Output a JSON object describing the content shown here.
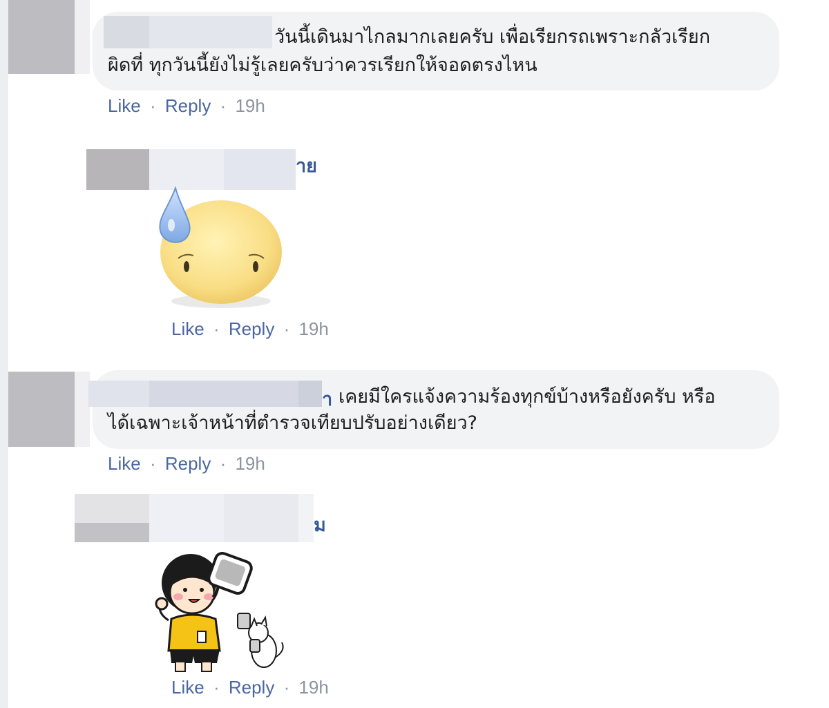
{
  "comments": [
    {
      "name_tail": "",
      "text_lines": [
        "วันนี้เดินมาไกลมากเลยครับ เพื่อเรียกรถเพราะกลัวเรียก",
        "ผิดที่ ทุกวันนี้ยังไม่รู้เลยครับว่าควรเรียกให้จอดตรงไหน"
      ],
      "like": "Like",
      "reply": "Reply",
      "time": "19h"
    },
    {
      "name_tail": "าย",
      "sticker": "sweating-blob-sticker",
      "like": "Like",
      "reply": "Reply",
      "time": "19h"
    },
    {
      "name_tail": "า",
      "text_lines": [
        "เคยมีใครแจ้งความร้องทุกข์บ้างหรือยังครับ หรือ",
        "ได้เฉพาะเจ้าหน้าที่ตำรวจเทียบปรับอย่างเดียว?"
      ],
      "like": "Like",
      "reply": "Reply",
      "time": "19h"
    },
    {
      "name_tail": "ม",
      "sticker": "girl-holding-phone-sticker",
      "like": "Like",
      "reply": "Reply",
      "time": "19h"
    }
  ],
  "separator": "·",
  "colors": {
    "bubble": "#f2f3f5",
    "link": "#4b67a1",
    "name": "#365899",
    "meta": "#8d949e"
  }
}
